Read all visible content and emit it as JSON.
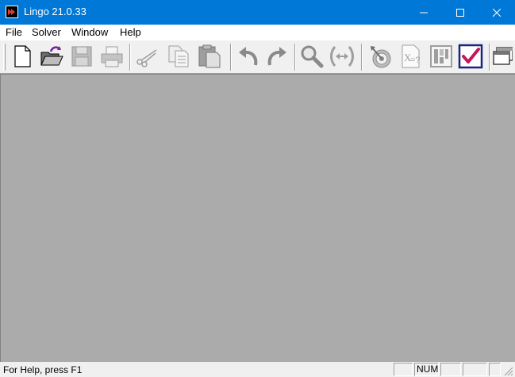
{
  "window": {
    "title": "Lingo 21.0.33"
  },
  "menu": [
    "File",
    "Solver",
    "Window",
    "Help"
  ],
  "toolbar": {
    "buttons": [
      "new",
      "open",
      "save",
      "print",
      "cut",
      "copy",
      "paste",
      "undo",
      "redo",
      "find",
      "match-parenthesis",
      "solve",
      "generate",
      "picture",
      "options"
    ],
    "accent_color": "#7b1fa2",
    "check_color": "#c2185b"
  },
  "status": {
    "help_text": "For Help, press F1",
    "panes": [
      "",
      "NUM",
      "",
      "",
      ""
    ]
  },
  "colors": {
    "titlebar": "#0078d7",
    "workspace": "#ababab"
  }
}
